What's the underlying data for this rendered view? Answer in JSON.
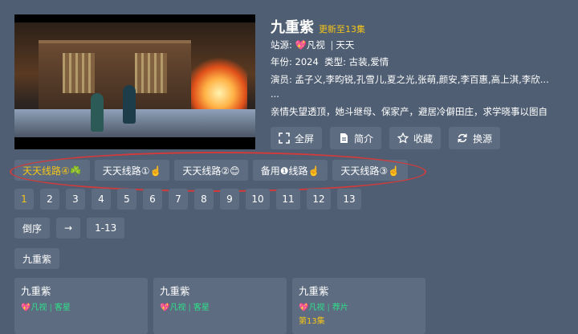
{
  "title": "九重紫",
  "update_badge": "更新至13集",
  "site": {
    "label": "站源:",
    "heart": "💖",
    "name": "凡视",
    "divider": "|",
    "sub": "天天"
  },
  "year": {
    "label": "年份:",
    "value": "2024",
    "type_label": "类型:",
    "type_value": "古装,爱情"
  },
  "cast": {
    "label": "演员:",
    "value": "孟子义,李昀锐,孔雪儿,夏之光,张萌,颜安,李百惠,高上淇,李欣..."
  },
  "ellipsis": "...",
  "synopsis": "亲情失望透顶，她斗继母、保家产，避居冷僻田庄，求学晓事以图自",
  "actions": [
    {
      "label": "全屏",
      "icon": "fullscreen-icon"
    },
    {
      "label": "简介",
      "icon": "document-icon"
    },
    {
      "label": "收藏",
      "icon": "star-icon"
    },
    {
      "label": "换源",
      "icon": "refresh-icon"
    }
  ],
  "lines": [
    {
      "label": "天天线路④☘️",
      "active": true
    },
    {
      "label": "天天线路①☝️",
      "active": false
    },
    {
      "label": "天天线路②😊",
      "active": false
    },
    {
      "label": "备用❶线路☝️",
      "active": false
    },
    {
      "label": "天天线路③☝️",
      "active": false
    }
  ],
  "episodes": [
    "1",
    "2",
    "3",
    "4",
    "5",
    "6",
    "7",
    "8",
    "9",
    "10",
    "11",
    "12",
    "13"
  ],
  "selected_episode": "1",
  "sort": {
    "order": "倒序",
    "arrow": "→",
    "range": "1-13"
  },
  "name_chip": "九重紫",
  "cards": [
    {
      "name": "九重紫",
      "heart": "💖",
      "source": "凡视",
      "divider": "|",
      "type": "客星",
      "episode": ""
    },
    {
      "name": "九重紫",
      "heart": "💖",
      "source": "凡视",
      "divider": "|",
      "type": "客星",
      "episode": ""
    },
    {
      "name": "九重紫",
      "heart": "💖",
      "source": "凡视",
      "divider": "|",
      "type": "荐片",
      "episode": "第13集"
    }
  ],
  "colors": {
    "background": "#4f5e72",
    "button": "#5d6c80",
    "accent": "#f5c518",
    "source_green": "#2ee08a",
    "annotation_red": "#d23b3b"
  }
}
